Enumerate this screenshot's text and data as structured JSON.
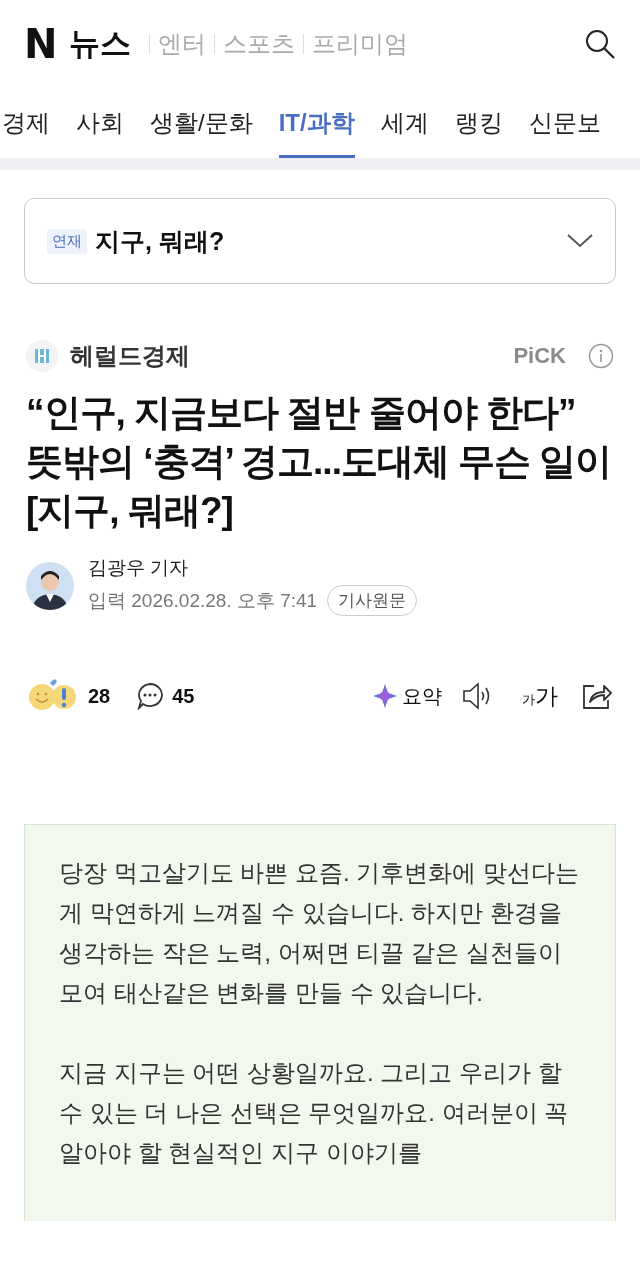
{
  "header": {
    "logo": "N",
    "title": "뉴스",
    "links": [
      "엔터",
      "스포츠",
      "프리미엄"
    ]
  },
  "tabs": [
    {
      "label": "경제",
      "selected": false
    },
    {
      "label": "사회",
      "selected": false
    },
    {
      "label": "생활/문화",
      "selected": false
    },
    {
      "label": "IT/과학",
      "selected": true
    },
    {
      "label": "세계",
      "selected": false
    },
    {
      "label": "랭킹",
      "selected": false
    },
    {
      "label": "신문보",
      "selected": false
    }
  ],
  "series": {
    "badge": "연재",
    "title": "지구, 뭐래?"
  },
  "article": {
    "press": "헤럴드경제",
    "pick": "PiCK",
    "headline": "“인구, 지금보다 절반 줄어야 한다” 뜻밖의 ‘충격’ 경고...도대체 무슨 일이 [지구, 뭐래?]",
    "reporter": "김광우 기자",
    "date": "입력 2026.02.28. 오후 7:41",
    "original_button": "기사원문"
  },
  "actions": {
    "reactions": "28",
    "comments": "45",
    "summary": "요약",
    "font_small": "가",
    "font_large": "가"
  },
  "summary": {
    "paragraphs": [
      "당장 먹고살기도 바쁜 요즘. 기후변화에 맞선다는 게 막연하게 느껴질 수 있습니다. 하지만 환경을 생각하는 작은 노력, 어쩌면 티끌 같은 실천들이 모여 태산같은 변화를 만들 수 있습니다.",
      "지금 지구는 어떤 상황일까요. 그리고 우리가 할 수 있는 더 나은 선택은 무엇일까요. 여러분이 꼭 알아야 할 현실적인 지구 이야기를"
    ]
  }
}
